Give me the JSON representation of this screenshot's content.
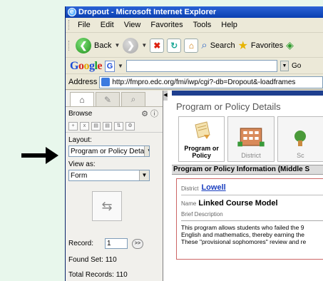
{
  "window": {
    "title": "Dropout - Microsoft Internet Explorer"
  },
  "menu": [
    "File",
    "Edit",
    "View",
    "Favorites",
    "Tools",
    "Help"
  ],
  "toolbar": {
    "back_label": "Back",
    "search_label": "Search",
    "favorites_label": "Favorites"
  },
  "google": {
    "logo_g": "G",
    "go_label": "Go"
  },
  "address": {
    "label": "Address",
    "url": "http://fmpro.edc.org/fmi/iwp/cgi?-db=Dropout&-loadframes"
  },
  "sidebar": {
    "browse_label": "Browse",
    "layout_label": "Layout:",
    "layout_value": "Program or Policy Deta",
    "view_as_label": "View as:",
    "view_as_value": "Form",
    "record_label": "Record:",
    "record_value": "1",
    "record_go": ">>",
    "found_set": "Found Set: 110",
    "total_records": "Total Records: 110"
  },
  "main": {
    "title": "Program or Policy Details",
    "cards": [
      {
        "label": "Program or Policy",
        "icon": "program-note-icon"
      },
      {
        "label": "District",
        "icon": "district-building-icon"
      },
      {
        "label": "Sc",
        "icon": "school-icon"
      }
    ],
    "section_title": "Program or Policy Information (Middle S",
    "district_label": "District",
    "district_value": "Lowell",
    "name_label": "Name",
    "name_value": "Linked Course Model",
    "brief_label": "Brief Description",
    "description_lines": [
      "This program allows students who failed the 9",
      "English and mathematics, thereby earning the",
      "These \"provisional sophomores\" review and re"
    ]
  }
}
